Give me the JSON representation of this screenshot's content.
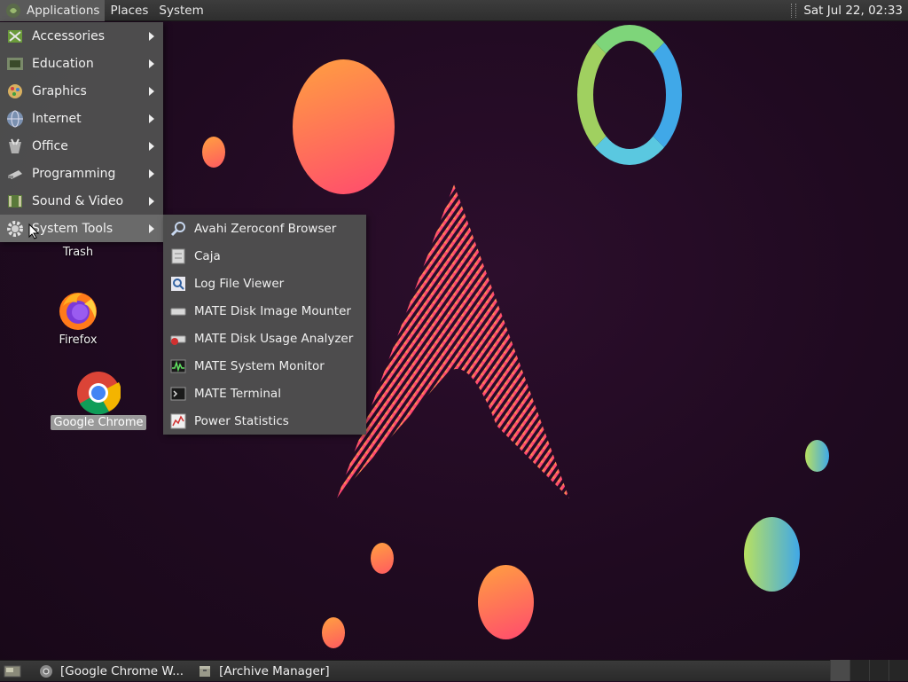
{
  "top_panel": {
    "menus": [
      "Applications",
      "Places",
      "System"
    ],
    "clock": "Sat Jul 22, 02:33"
  },
  "applications_menu": {
    "items": [
      {
        "label": "Accessories",
        "icon": "accessories-icon"
      },
      {
        "label": "Education",
        "icon": "education-icon"
      },
      {
        "label": "Graphics",
        "icon": "graphics-icon"
      },
      {
        "label": "Internet",
        "icon": "internet-icon"
      },
      {
        "label": "Office",
        "icon": "office-icon"
      },
      {
        "label": "Programming",
        "icon": "programming-icon"
      },
      {
        "label": "Sound & Video",
        "icon": "sound-video-icon"
      },
      {
        "label": "System Tools",
        "icon": "system-tools-icon",
        "highlighted": true
      }
    ]
  },
  "system_tools_submenu": {
    "items": [
      {
        "label": "Avahi Zeroconf Browser",
        "icon": "avahi-icon"
      },
      {
        "label": "Caja",
        "icon": "caja-icon"
      },
      {
        "label": "Log File Viewer",
        "icon": "log-viewer-icon"
      },
      {
        "label": "MATE Disk Image Mounter",
        "icon": "disk-mounter-icon"
      },
      {
        "label": "MATE Disk Usage Analyzer",
        "icon": "disk-usage-icon"
      },
      {
        "label": "MATE System Monitor",
        "icon": "system-monitor-icon"
      },
      {
        "label": "MATE Terminal",
        "icon": "terminal-icon"
      },
      {
        "label": "Power Statistics",
        "icon": "power-stats-icon"
      }
    ]
  },
  "desktop": {
    "icons": [
      {
        "label": "Trash",
        "icon": "trash-icon"
      },
      {
        "label": "Firefox",
        "icon": "firefox-icon"
      },
      {
        "label": "Google Chrome",
        "icon": "chrome-icon",
        "selected": true
      }
    ]
  },
  "bottom_panel": {
    "tasks": [
      {
        "label": "[Google Chrome W...",
        "icon": "chrome-icon"
      },
      {
        "label": "[Archive Manager]",
        "icon": "archive-manager-icon"
      }
    ]
  },
  "colors": {
    "panel": "#2e2e2e",
    "menu": "#4e4e4e",
    "highlight": "#6a6a6a",
    "desktop_bg": "#1f0a20"
  }
}
